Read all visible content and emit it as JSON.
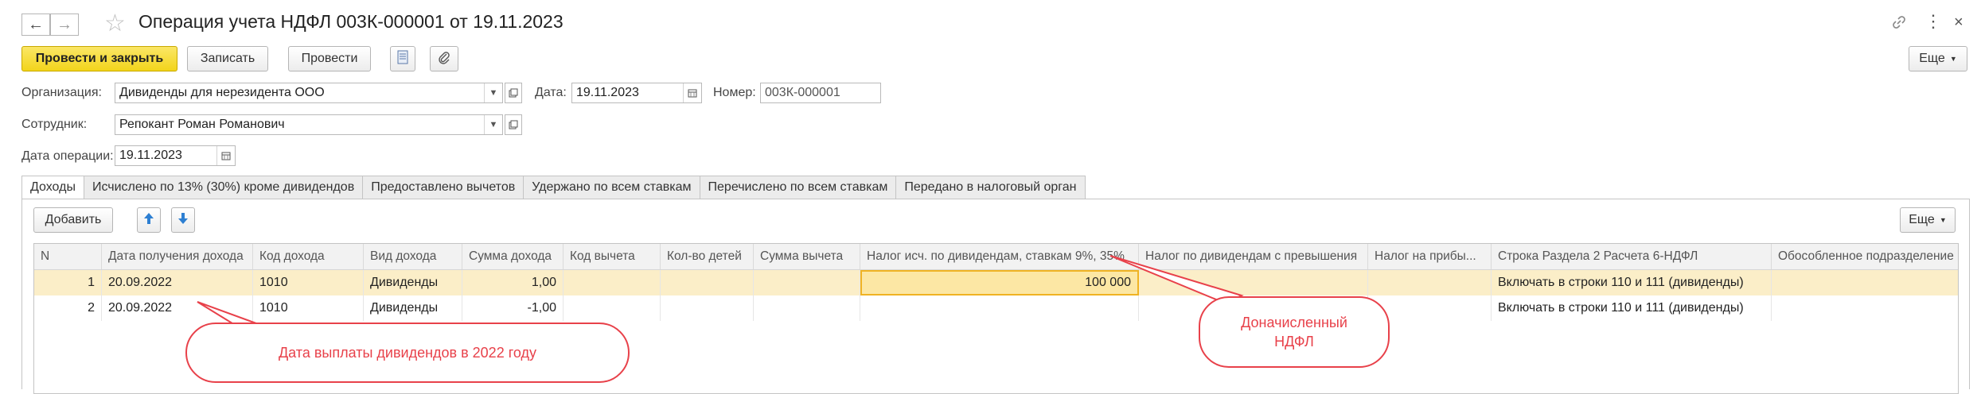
{
  "window": {
    "title": "Операция учета НДФЛ 003К-000001 от 19.11.2023"
  },
  "toolbar": {
    "post_and_close": "Провести и закрыть",
    "save": "Записать",
    "post": "Провести",
    "more": "Еще"
  },
  "form": {
    "org_label": "Организация:",
    "org_value": "Дивиденды для нерезидента ООО",
    "date_label": "Дата:",
    "date_value": "19.11.2023",
    "number_label": "Номер:",
    "number_value": "003К-000001",
    "employee_label": "Сотрудник:",
    "employee_value": "Репокант Роман Романович",
    "op_date_label": "Дата операции:",
    "op_date_value": "19.11.2023"
  },
  "tabs": [
    {
      "label": "Доходы",
      "active": true
    },
    {
      "label": "Исчислено по 13% (30%) кроме дивидендов"
    },
    {
      "label": "Предоставлено вычетов"
    },
    {
      "label": "Удержано по всем ставкам"
    },
    {
      "label": "Перечислено по всем ставкам"
    },
    {
      "label": "Передано в налоговый орган"
    }
  ],
  "table_toolbar": {
    "add": "Добавить",
    "more": "Еще"
  },
  "table": {
    "columns": [
      "N",
      "Дата получения дохода",
      "Код дохода",
      "Вид дохода",
      "Сумма дохода",
      "Код вычета",
      "Кол-во детей",
      "Сумма вычета",
      "Налог исч. по дивидендам, ставкам 9%, 35%",
      "Налог по дивидендам с превышения",
      "Налог на прибы...",
      "Строка Раздела 2 Расчета 6-НДФЛ",
      "Обособленное подразделение"
    ],
    "rows": [
      {
        "n": "1",
        "date": "20.09.2022",
        "code": "1010",
        "kind": "Дивиденды",
        "amount": "1,00",
        "tax": "100 000",
        "line": "Включать в строки 110 и 111 (дивиденды)"
      },
      {
        "n": "2",
        "date": "20.09.2022",
        "code": "1010",
        "kind": "Дивиденды",
        "amount": "-1,00",
        "tax": "",
        "line": "Включать в строки 110 и 111 (дивиденды)"
      }
    ]
  },
  "annotations": {
    "date_callout": "Дата выплаты дивидендов в 2022 году",
    "tax_callout_line1": "Доначисленный",
    "tax_callout_line2": "НДФЛ"
  },
  "icons": [
    "back-arrow-icon",
    "forward-arrow-icon",
    "star-icon",
    "link-icon",
    "kebab-menu-icon",
    "close-icon",
    "document-icon",
    "paperclip-icon",
    "dropdown-arrow-icon",
    "open-form-icon",
    "calendar-icon",
    "arrow-up-icon",
    "arrow-down-icon"
  ],
  "colors": {
    "primary_button": "#f2d41b",
    "selected_row": "#fbeec8",
    "annotation": "#e8414a",
    "move_arrows": "#2d7fd2"
  }
}
